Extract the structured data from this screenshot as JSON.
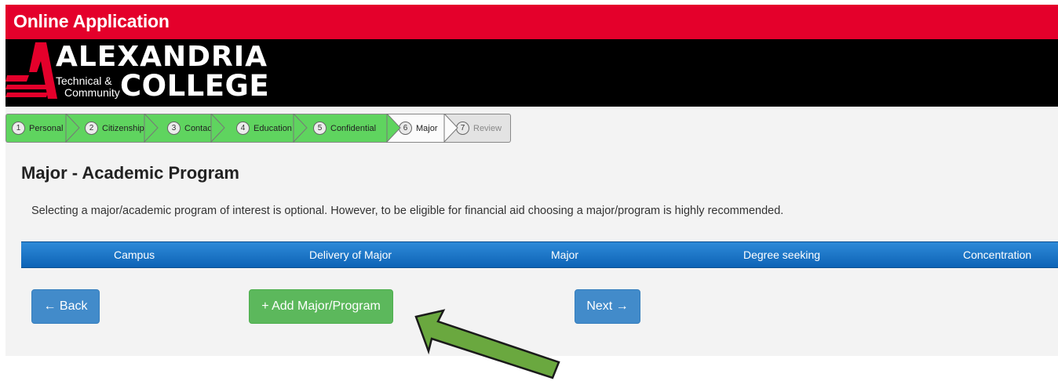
{
  "header": {
    "title": "Online Application",
    "brand_name": "ALEXANDRIA",
    "brand_sub1": "Technical &",
    "brand_sub2": "Community",
    "brand_college": "COLLEGE"
  },
  "steps": [
    {
      "num": "1",
      "label": "Personal",
      "state": "done"
    },
    {
      "num": "2",
      "label": "Citizenship",
      "state": "done"
    },
    {
      "num": "3",
      "label": "Contact",
      "state": "done"
    },
    {
      "num": "4",
      "label": "Education",
      "state": "done"
    },
    {
      "num": "5",
      "label": "Confidential",
      "state": "done"
    },
    {
      "num": "6",
      "label": "Major",
      "state": "current"
    },
    {
      "num": "7",
      "label": "Review",
      "state": "todo"
    }
  ],
  "main": {
    "title": "Major - Academic Program",
    "intro": "Selecting a major/academic program of interest is optional. However, to be eligible for financial aid choosing a major/program is highly recommended.",
    "columns": [
      "Campus",
      "Delivery of Major",
      "Major",
      "Degree seeking",
      "Concentration"
    ]
  },
  "buttons": {
    "back": "← Back",
    "add": "+ Add Major/Program",
    "next": "Next →"
  },
  "colors": {
    "brand_red": "#e4002b",
    "table_header_blue": "#1172c4",
    "step_done_green": "#5fd45f",
    "button_blue": "#428bca",
    "button_green": "#5cb85c",
    "callout_arrow_green": "#6aa83f"
  },
  "icons": {
    "logo": "alexandria-a-logo-icon",
    "callout": "pointing-arrow-icon"
  }
}
